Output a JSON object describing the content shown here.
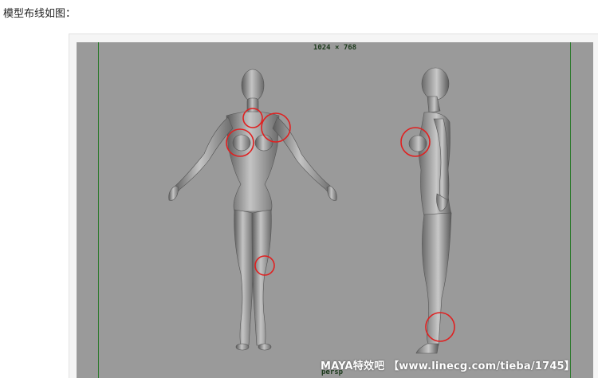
{
  "post": {
    "caption": "模型布线如图："
  },
  "viewport": {
    "resolution_label": "1024 × 768",
    "camera_label": "persp",
    "watermark": "MAYA特效吧 【www.linecg.com/tieba/1745】",
    "gate_line_color": "#2f7a2f",
    "background_color": "#9a9a9a",
    "highlight_color": "#e02020"
  }
}
